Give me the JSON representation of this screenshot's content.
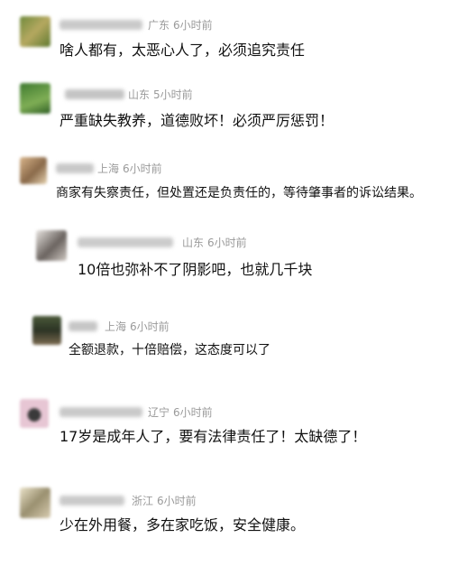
{
  "comments": [
    {
      "location": "广东",
      "time": "6小时前",
      "text": "啥人都有，太恶心人了，必须追究责任"
    },
    {
      "location": "山东",
      "time": "5小时前",
      "text": "严重缺失教养，道德败坏！必须严厉惩罚！"
    },
    {
      "location": "上海",
      "time": "6小时前",
      "text": "商家有失察责任，但处置还是负责任的，等待肇事者的诉讼结果。"
    },
    {
      "location": "山东",
      "time": "6小时前",
      "text": "10倍也弥补不了阴影吧，也就几千块"
    },
    {
      "location": "上海",
      "time": "6小时前",
      "text": "全额退款，十倍赔偿，这态度可以了"
    },
    {
      "location": "辽宁",
      "time": "6小时前",
      "text": "17岁是成年人了，要有法律责任了！太缺德了！"
    },
    {
      "location": "浙江",
      "time": "6小时前",
      "text": "少在外用餐，多在家吃饭，安全健康。"
    }
  ],
  "colors": {
    "meta": "#9a9a9a",
    "text": "#111111",
    "background": "#ffffff"
  }
}
